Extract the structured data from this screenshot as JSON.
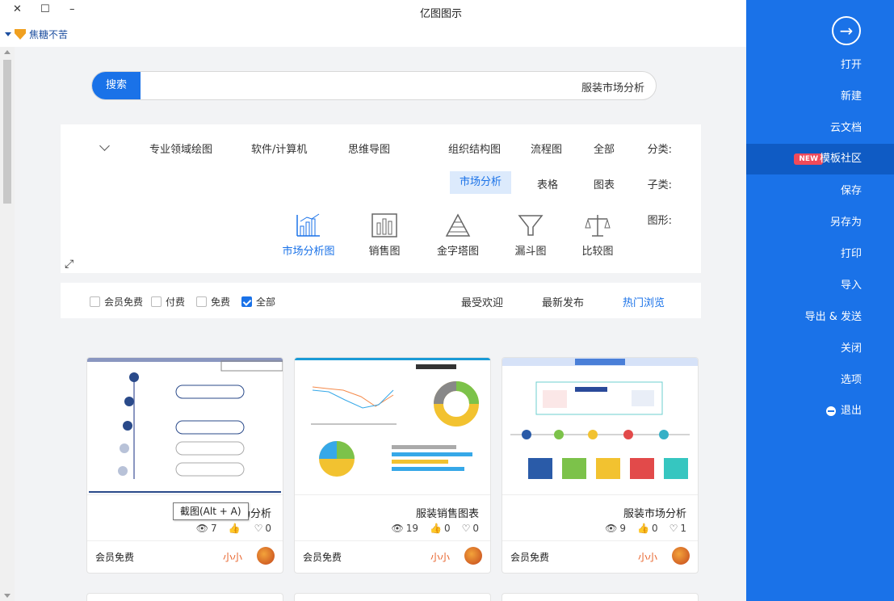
{
  "window": {
    "title": "亿图图示",
    "minimize": "–",
    "maximize": "☐",
    "close": "✕"
  },
  "user": {
    "name": "焦糖不苦"
  },
  "sidebar": {
    "items": [
      {
        "label": "打开",
        "active": false
      },
      {
        "label": "新建",
        "active": false
      },
      {
        "label": "云文档",
        "active": false
      },
      {
        "label": "模板社区",
        "active": true,
        "badge": "NEW"
      },
      {
        "label": "保存",
        "active": false
      },
      {
        "label": "另存为",
        "active": false
      },
      {
        "label": "打印",
        "active": false
      },
      {
        "label": "导入",
        "active": false
      },
      {
        "label": "导出 & 发送",
        "active": false
      },
      {
        "label": "关闭",
        "active": false
      },
      {
        "label": "选项",
        "active": false
      },
      {
        "label": "退出",
        "active": false
      }
    ]
  },
  "search": {
    "button": "搜索",
    "value": "服装市场分析"
  },
  "filters": {
    "category_label": "分类:",
    "categories": [
      "全部",
      "流程图",
      "组织结构图",
      "思维导图",
      "软件/计算机",
      "专业领域绘图"
    ],
    "subcategory_label": "子类:",
    "subcategories": [
      "图表",
      "表格",
      "市场分析"
    ],
    "active_subcategory": "市场分析",
    "figure_label": "图形:",
    "figures": [
      {
        "label": "比较图",
        "icon": "scale-icon"
      },
      {
        "label": "漏斗图",
        "icon": "funnel-icon"
      },
      {
        "label": "金字塔图",
        "icon": "pyramid-icon"
      },
      {
        "label": "销售图",
        "icon": "bar-chart-icon"
      },
      {
        "label": "市场分析图",
        "icon": "market-chart-icon",
        "active": true
      }
    ]
  },
  "sort": {
    "tabs": [
      "热门浏览",
      "最新发布",
      "最受欢迎"
    ],
    "active": "热门浏览",
    "checks": [
      {
        "label": "全部",
        "checked": true
      },
      {
        "label": "免费",
        "checked": false
      },
      {
        "label": "付费",
        "checked": false
      },
      {
        "label": "会员免费",
        "checked": false
      }
    ]
  },
  "cards": [
    {
      "title": "服装市场分析",
      "views": "9",
      "likes": "0",
      "favs": "1",
      "author": "小小",
      "tier": "会员免费"
    },
    {
      "title": "服装销售图表",
      "views": "19",
      "likes": "0",
      "favs": "0",
      "author": "小小",
      "tier": "会员免费"
    },
    {
      "title": "装饰市场分析",
      "views": "7",
      "likes": "",
      "favs": "0",
      "author": "小小",
      "tier": "会员免费"
    }
  ],
  "tooltip": "截图(Alt + A)",
  "colors": {
    "accent": "#1a72e8",
    "sidebar": "#1a72e8",
    "author": "#e8622a",
    "badge": "#f04a5a"
  }
}
